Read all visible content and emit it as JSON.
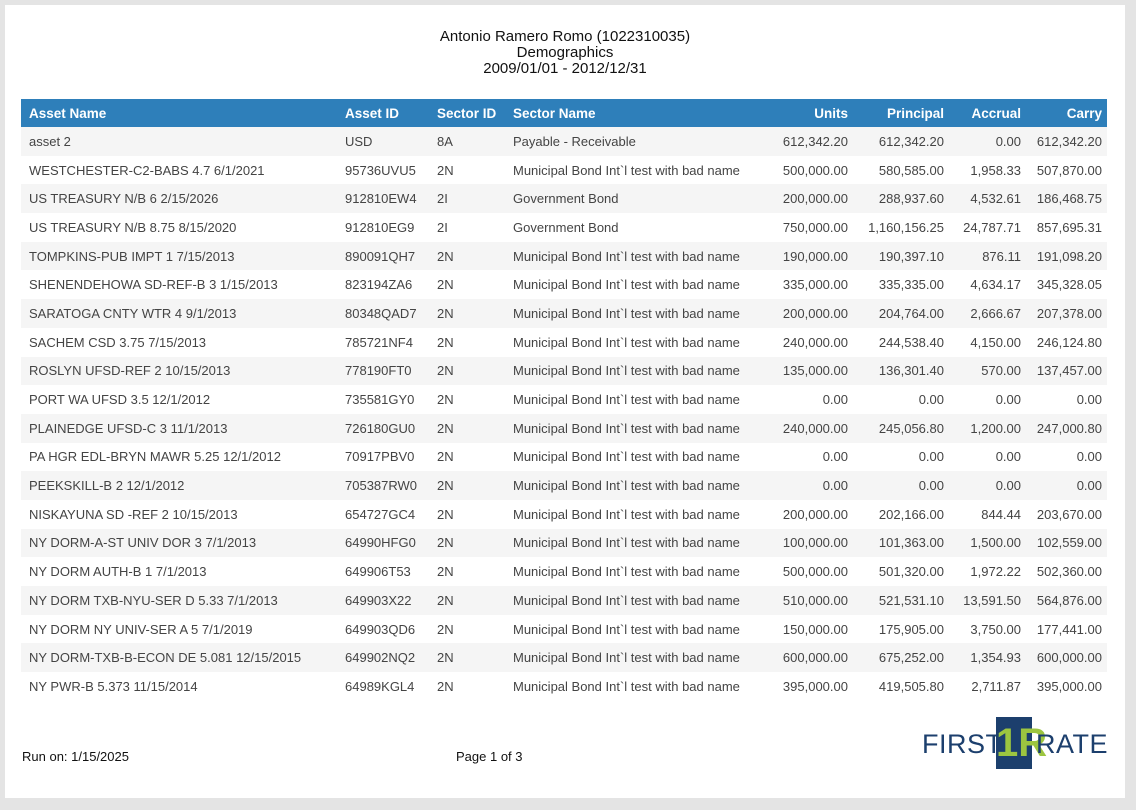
{
  "report": {
    "title": "Antonio Ramero Romo (1022310035)",
    "subtitle": "Demographics",
    "date_range": "2009/01/01 - 2012/12/31"
  },
  "table": {
    "columns": [
      "Asset Name",
      "Asset ID",
      "Sector ID",
      "Sector Name",
      "Units",
      "Principal",
      "Accrual",
      "Carry"
    ],
    "rows": [
      [
        "asset 2",
        "USD",
        "8A",
        "Payable - Receivable",
        "612,342.20",
        "612,342.20",
        "0.00",
        "612,342.20"
      ],
      [
        "WESTCHESTER-C2-BABS 4.7 6/1/2021",
        "95736UVU5",
        "2N",
        "Municipal Bond Int`l test with bad name",
        "500,000.00",
        "580,585.00",
        "1,958.33",
        "507,870.00"
      ],
      [
        "US TREASURY N/B 6 2/15/2026",
        "912810EW4",
        "2I",
        "Government Bond",
        "200,000.00",
        "288,937.60",
        "4,532.61",
        "186,468.75"
      ],
      [
        "US TREASURY N/B 8.75 8/15/2020",
        "912810EG9",
        "2I",
        "Government Bond",
        "750,000.00",
        "1,160,156.25",
        "24,787.71",
        "857,695.31"
      ],
      [
        "TOMPKINS-PUB IMPT 1 7/15/2013",
        "890091QH7",
        "2N",
        "Municipal Bond Int`l test with bad name",
        "190,000.00",
        "190,397.10",
        "876.11",
        "191,098.20"
      ],
      [
        "SHENENDEHOWA SD-REF-B 3 1/15/2013",
        "823194ZA6",
        "2N",
        "Municipal Bond Int`l test with bad name",
        "335,000.00",
        "335,335.00",
        "4,634.17",
        "345,328.05"
      ],
      [
        "SARATOGA CNTY WTR 4 9/1/2013",
        "80348QAD7",
        "2N",
        "Municipal Bond Int`l test with bad name",
        "200,000.00",
        "204,764.00",
        "2,666.67",
        "207,378.00"
      ],
      [
        "SACHEM CSD 3.75 7/15/2013",
        "785721NF4",
        "2N",
        "Municipal Bond Int`l test with bad name",
        "240,000.00",
        "244,538.40",
        "4,150.00",
        "246,124.80"
      ],
      [
        "ROSLYN UFSD-REF 2 10/15/2013",
        "778190FT0",
        "2N",
        "Municipal Bond Int`l test with bad name",
        "135,000.00",
        "136,301.40",
        "570.00",
        "137,457.00"
      ],
      [
        "PORT WA UFSD 3.5 12/1/2012",
        "735581GY0",
        "2N",
        "Municipal Bond Int`l test with bad name",
        "0.00",
        "0.00",
        "0.00",
        "0.00"
      ],
      [
        "PLAINEDGE UFSD-C 3 11/1/2013",
        "726180GU0",
        "2N",
        "Municipal Bond Int`l test with bad name",
        "240,000.00",
        "245,056.80",
        "1,200.00",
        "247,000.80"
      ],
      [
        "PA HGR EDL-BRYN MAWR 5.25 12/1/2012",
        "70917PBV0",
        "2N",
        "Municipal Bond Int`l test with bad name",
        "0.00",
        "0.00",
        "0.00",
        "0.00"
      ],
      [
        "PEEKSKILL-B 2 12/1/2012",
        "705387RW0",
        "2N",
        "Municipal Bond Int`l test with bad name",
        "0.00",
        "0.00",
        "0.00",
        "0.00"
      ],
      [
        "NISKAYUNA SD -REF 2 10/15/2013",
        "654727GC4",
        "2N",
        "Municipal Bond Int`l test with bad name",
        "200,000.00",
        "202,166.00",
        "844.44",
        "203,670.00"
      ],
      [
        "NY DORM-A-ST UNIV DOR 3 7/1/2013",
        "64990HFG0",
        "2N",
        "Municipal Bond Int`l test with bad name",
        "100,000.00",
        "101,363.00",
        "1,500.00",
        "102,559.00"
      ],
      [
        "NY DORM AUTH-B 1 7/1/2013",
        "649906T53",
        "2N",
        "Municipal Bond Int`l test with bad name",
        "500,000.00",
        "501,320.00",
        "1,972.22",
        "502,360.00"
      ],
      [
        "NY DORM TXB-NYU-SER D 5.33 7/1/2013",
        "649903X22",
        "2N",
        "Municipal Bond Int`l test with bad name",
        "510,000.00",
        "521,531.10",
        "13,591.50",
        "564,876.00"
      ],
      [
        "NY DORM NY UNIV-SER A 5 7/1/2019",
        "649903QD6",
        "2N",
        "Municipal Bond Int`l test with bad name",
        "150,000.00",
        "175,905.00",
        "3,750.00",
        "177,441.00"
      ],
      [
        "NY DORM-TXB-B-ECON DE 5.081 12/15/2015",
        "649902NQ2",
        "2N",
        "Municipal Bond Int`l test with bad name",
        "600,000.00",
        "675,252.00",
        "1,354.93",
        "600,000.00"
      ],
      [
        "NY PWR-B 5.373 11/15/2014",
        "64989KGL4",
        "2N",
        "Municipal Bond Int`l test with bad name",
        "395,000.00",
        "419,505.80",
        "2,711.87",
        "395,000.00"
      ]
    ]
  },
  "footer": {
    "run_on": "Run on: 1/15/2025",
    "page": "Page 1 of 3"
  },
  "logo": {
    "left": "FIRST",
    "mark": "1R",
    "right": "RATE"
  },
  "colors": {
    "header_bg": "#2e7fba",
    "logo_navy": "#1c3f6d",
    "logo_green": "#9cc540"
  }
}
